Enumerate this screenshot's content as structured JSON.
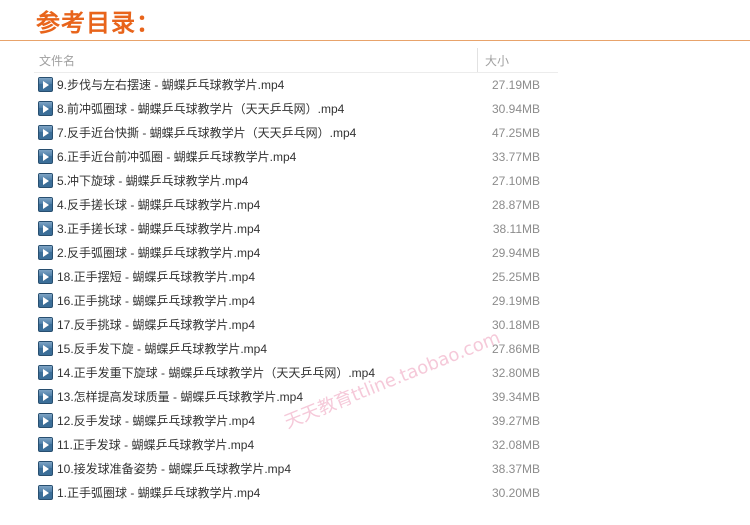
{
  "page": {
    "title": "参考目录："
  },
  "table": {
    "headers": {
      "name": "文件名",
      "size": "大小"
    },
    "rows": [
      {
        "name": "9.步伐与左右摆速 - 蝴蝶乒乓球教学片.mp4",
        "size": "27.19MB"
      },
      {
        "name": "8.前冲弧圈球 -  蝴蝶乒乓球教学片（天天乒乓网）.mp4",
        "size": "30.94MB"
      },
      {
        "name": "7.反手近台快撕 - 蝴蝶乒乓球教学片（天天乒乓网）.mp4",
        "size": "47.25MB"
      },
      {
        "name": "6.正手近台前冲弧圈  -  蝴蝶乒乓球教学片.mp4",
        "size": "33.77MB"
      },
      {
        "name": "5.冲下旋球  -  蝴蝶乒乓球教学片.mp4",
        "size": "27.10MB"
      },
      {
        "name": "4.反手搓长球 - 蝴蝶乒乓球教学片.mp4",
        "size": "28.87MB"
      },
      {
        "name": "3.正手搓长球 - 蝴蝶乒乓球教学片.mp4",
        "size": "38.11MB"
      },
      {
        "name": "2.反手弧圈球 - 蝴蝶乒乓球教学片.mp4",
        "size": "29.94MB"
      },
      {
        "name": "18.正手摆短  -  蝴蝶乒乓球教学片.mp4",
        "size": "25.25MB"
      },
      {
        "name": "16.正手挑球 - 蝴蝶乒乓球教学片.mp4",
        "size": "29.19MB"
      },
      {
        "name": "17.反手挑球  -  蝴蝶乒乓球教学片.mp4",
        "size": "30.18MB"
      },
      {
        "name": "15.反手发下旋 - 蝴蝶乒乓球教学片.mp4",
        "size": "27.86MB"
      },
      {
        "name": "14.正手发重下旋球 - 蝴蝶乒乓球教学片（天天乒乓网）.mp4",
        "size": "32.80MB"
      },
      {
        "name": "13.怎样提高发球质量 - 蝴蝶乒乓球教学片.mp4",
        "size": "39.34MB"
      },
      {
        "name": "12.反手发球 - 蝴蝶乒乓球教学片.mp4",
        "size": "39.27MB"
      },
      {
        "name": "11.正手发球 - 蝴蝶乒乓球教学片.mp4",
        "size": "32.08MB"
      },
      {
        "name": "10.接发球准备姿势 - 蝴蝶乒乓球教学片.mp4",
        "size": "38.37MB"
      },
      {
        "name": "1.正手弧圈球 - 蝴蝶乒乓球教学片.mp4",
        "size": "30.20MB"
      }
    ]
  },
  "watermark": {
    "text": "天天教育ttline.taobao.com"
  },
  "colors": {
    "title": "#e8641b",
    "icon": "#3b6e98",
    "watermark": "#f2b3ca"
  },
  "icons": {
    "file": "video-file-icon"
  }
}
